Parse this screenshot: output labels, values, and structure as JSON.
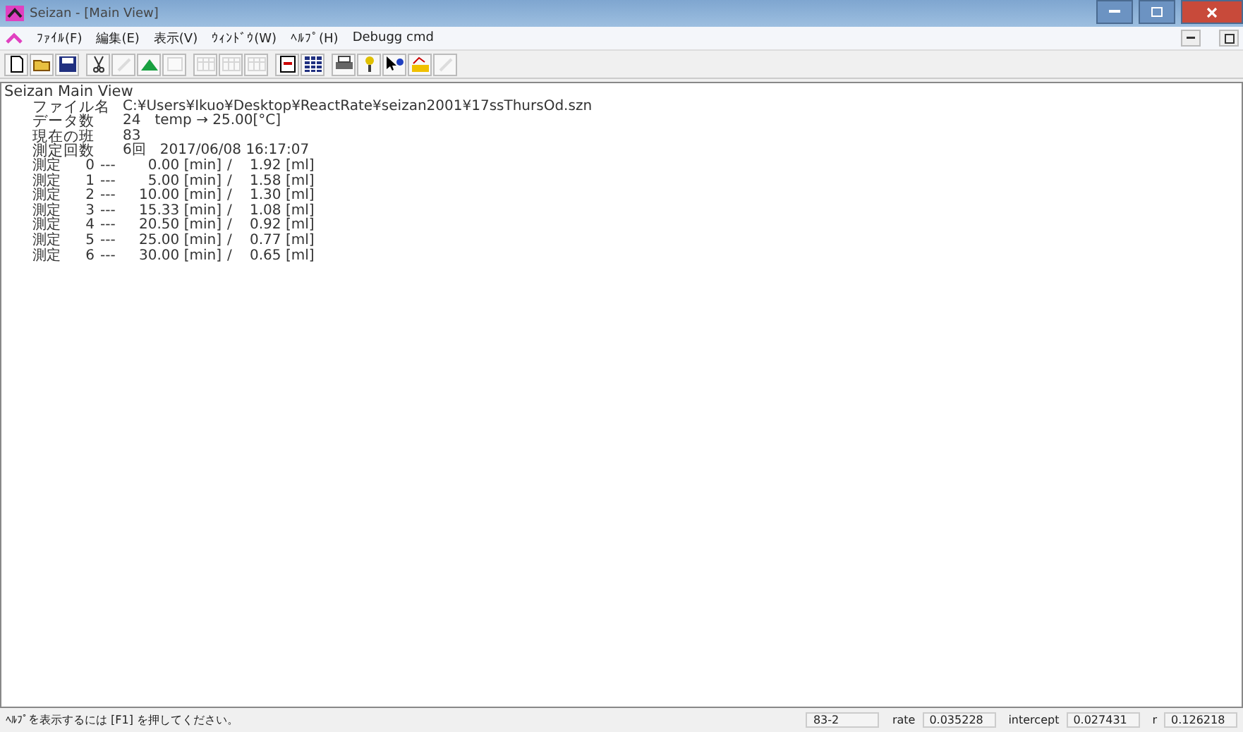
{
  "window": {
    "title": "Seizan - [Main View]"
  },
  "menu": [
    "ﾌｧｲﾙ(F)",
    "編集(E)",
    "表示(V)",
    "ｳｨﾝﾄﾞｳ(W)",
    "ﾍﾙﾌﾟ(H)",
    "Debugg cmd"
  ],
  "toolbar": [
    [
      {
        "disabled": false
      },
      {
        "disabled": false
      },
      {
        "disabled": false
      }
    ],
    [
      {
        "disabled": false
      },
      {
        "disabled": true
      },
      {
        "disabled": false
      },
      {
        "disabled": true
      }
    ],
    [
      {
        "disabled": true
      },
      {
        "disabled": true
      },
      {
        "disabled": true
      }
    ],
    [
      {
        "disabled": false
      },
      {
        "disabled": false
      }
    ],
    [
      {
        "disabled": false
      },
      {
        "disabled": false
      },
      {
        "disabled": false
      },
      {
        "disabled": false
      },
      {
        "disabled": true
      }
    ]
  ],
  "view": {
    "heading": "Seizan Main View",
    "fields": [
      {
        "label": "ファイル名",
        "value": "C:¥Users¥Ikuo¥Desktop¥ReactRate¥seizan2001¥17ssThursOd.szn"
      },
      {
        "label": "データ数",
        "value": "24",
        "extra": "temp → 25.00[°C]"
      },
      {
        "label": "現在の班",
        "value": "83"
      },
      {
        "label": "測定回数",
        "value": "6回",
        "extra": "2017/06/08   16:17:07"
      }
    ],
    "measurements": [
      {
        "label": "測定",
        "index": "0",
        "sep": "---",
        "time": "0.00 [min]",
        "slash": "/",
        "volume": "1.92 [ml]"
      },
      {
        "label": "測定",
        "index": "1",
        "sep": "---",
        "time": "5.00 [min]",
        "slash": "/",
        "volume": "1.58 [ml]"
      },
      {
        "label": "測定",
        "index": "2",
        "sep": "---",
        "time": "10.00 [min]",
        "slash": "/",
        "volume": "1.30 [ml]"
      },
      {
        "label": "測定",
        "index": "3",
        "sep": "---",
        "time": "15.33 [min]",
        "slash": "/",
        "volume": "1.08 [ml]"
      },
      {
        "label": "測定",
        "index": "4",
        "sep": "---",
        "time": "20.50 [min]",
        "slash": "/",
        "volume": "0.92 [ml]"
      },
      {
        "label": "測定",
        "index": "5",
        "sep": "---",
        "time": "25.00 [min]",
        "slash": "/",
        "volume": "0.77 [ml]"
      },
      {
        "label": "測定",
        "index": "6",
        "sep": "---",
        "time": "30.00 [min]",
        "slash": "/",
        "volume": "0.65 [ml]"
      }
    ]
  },
  "status_bar": {
    "message": "ﾍﾙﾌﾟを表示するには [F1] を押してください。",
    "group": "83-2",
    "stats": [
      {
        "label": "rate",
        "value": "0.035228"
      },
      {
        "label": "intercept",
        "value": "0.027431"
      },
      {
        "label": "r",
        "value": "0.126218"
      }
    ]
  }
}
